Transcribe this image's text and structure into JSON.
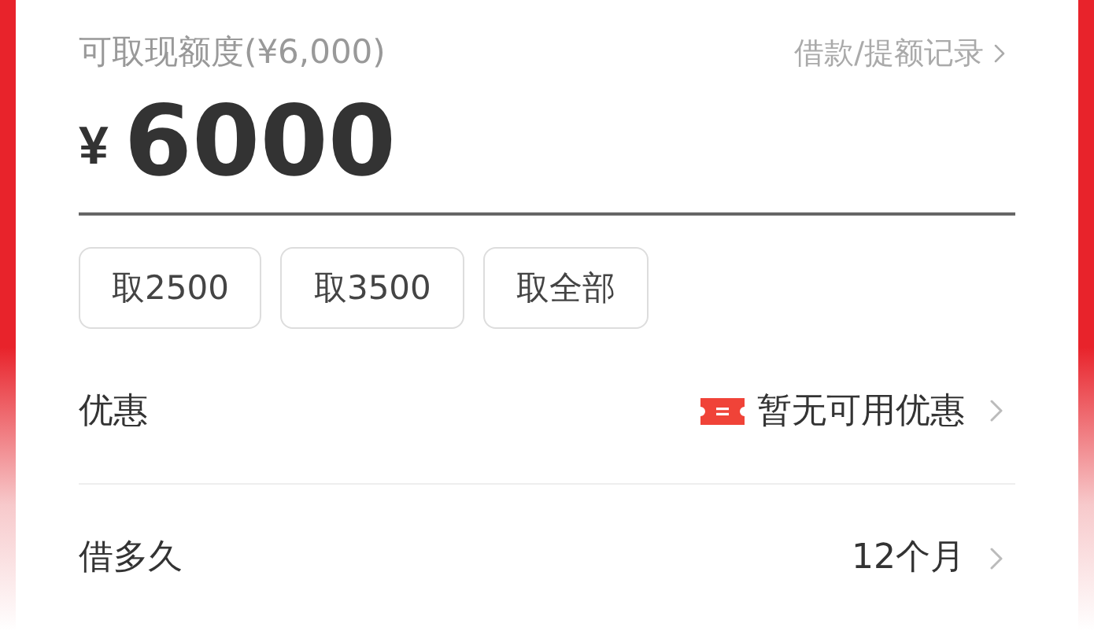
{
  "header": {
    "title": "可取现额度(¥6,000)",
    "link": "借款/提额记录"
  },
  "amount": {
    "currency": "¥",
    "value": "6000"
  },
  "quick_buttons": [
    "取2500",
    "取3500",
    "取全部"
  ],
  "rows": [
    {
      "label": "优惠",
      "value": "暂无可用优惠",
      "kind": "coupon"
    },
    {
      "label": "借多久",
      "value": "12个月",
      "kind": "plain"
    }
  ]
}
